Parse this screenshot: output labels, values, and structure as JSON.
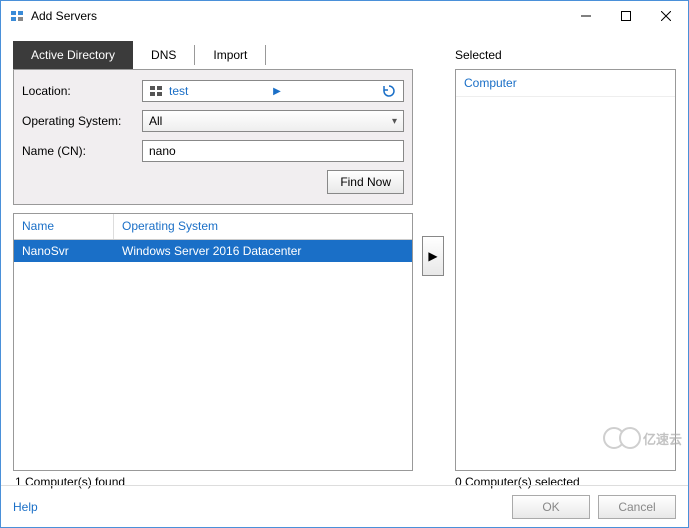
{
  "window": {
    "title": "Add Servers"
  },
  "tabs": {
    "active_directory": "Active Directory",
    "dns": "DNS",
    "import": "Import"
  },
  "filters": {
    "location_label": "Location:",
    "location_value": "test",
    "os_label": "Operating System:",
    "os_value": "All",
    "name_label": "Name (CN):",
    "name_value": "nano",
    "find_now": "Find Now"
  },
  "results": {
    "col_name": "Name",
    "col_os": "Operating System",
    "rows": [
      {
        "name": "NanoSvr",
        "os": "Windows Server 2016 Datacenter",
        "selected": true
      }
    ]
  },
  "selected_panel": {
    "title": "Selected",
    "col_computer": "Computer"
  },
  "status": {
    "found": "1 Computer(s) found",
    "selected": "0 Computer(s) selected"
  },
  "buttons": {
    "help": "Help",
    "ok": "OK",
    "cancel": "Cancel"
  },
  "watermark": {
    "text": "亿速云"
  }
}
